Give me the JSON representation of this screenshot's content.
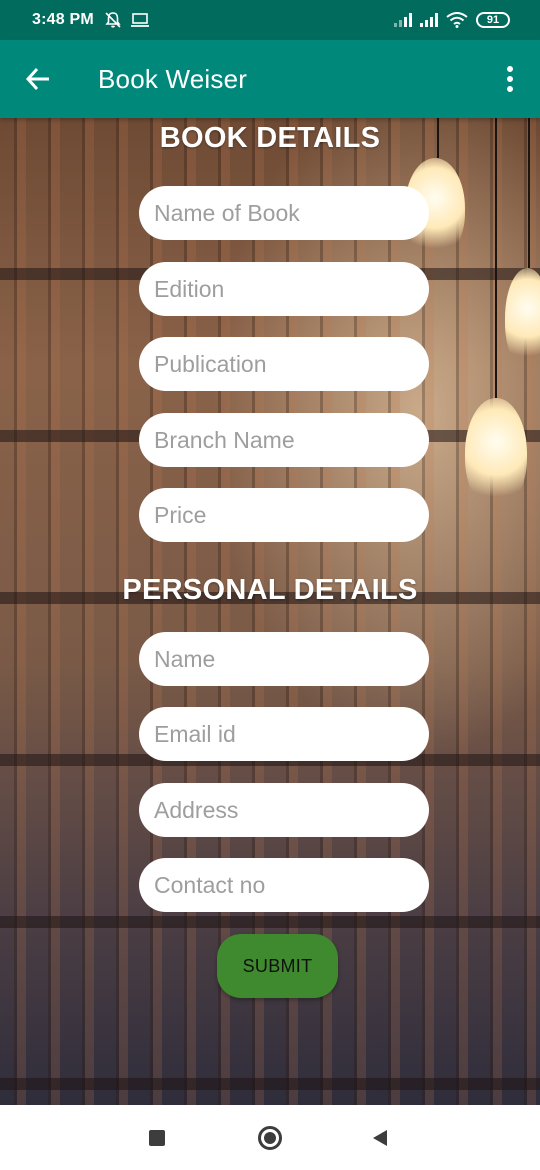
{
  "status_bar": {
    "time": "3:48 PM",
    "battery": "91"
  },
  "app_bar": {
    "title": "Book Weiser",
    "background": "#00897b"
  },
  "book_section": {
    "title": "BOOK DETAILS",
    "fields": [
      {
        "placeholder": "Name of Book"
      },
      {
        "placeholder": "Edition"
      },
      {
        "placeholder": "Publication"
      },
      {
        "placeholder": "Branch Name"
      },
      {
        "placeholder": "Price"
      }
    ]
  },
  "personal_section": {
    "title": "PERSONAL DETAILS",
    "fields": [
      {
        "placeholder": "Name"
      },
      {
        "placeholder": "Email id"
      },
      {
        "placeholder": "Address"
      },
      {
        "placeholder": "Contact no"
      }
    ]
  },
  "submit": {
    "label": "SUBMIT",
    "color": "#3f8a2f"
  },
  "icons": {
    "status_left": [
      "mute-notifications-icon",
      "screen-cast-icon"
    ],
    "status_right": [
      "signal-icon",
      "signal-icon",
      "wifi-icon",
      "battery-icon"
    ],
    "app_bar": [
      "back-arrow-icon",
      "more-vert-icon"
    ],
    "nav": [
      "recents-icon",
      "home-icon",
      "back-icon"
    ]
  }
}
